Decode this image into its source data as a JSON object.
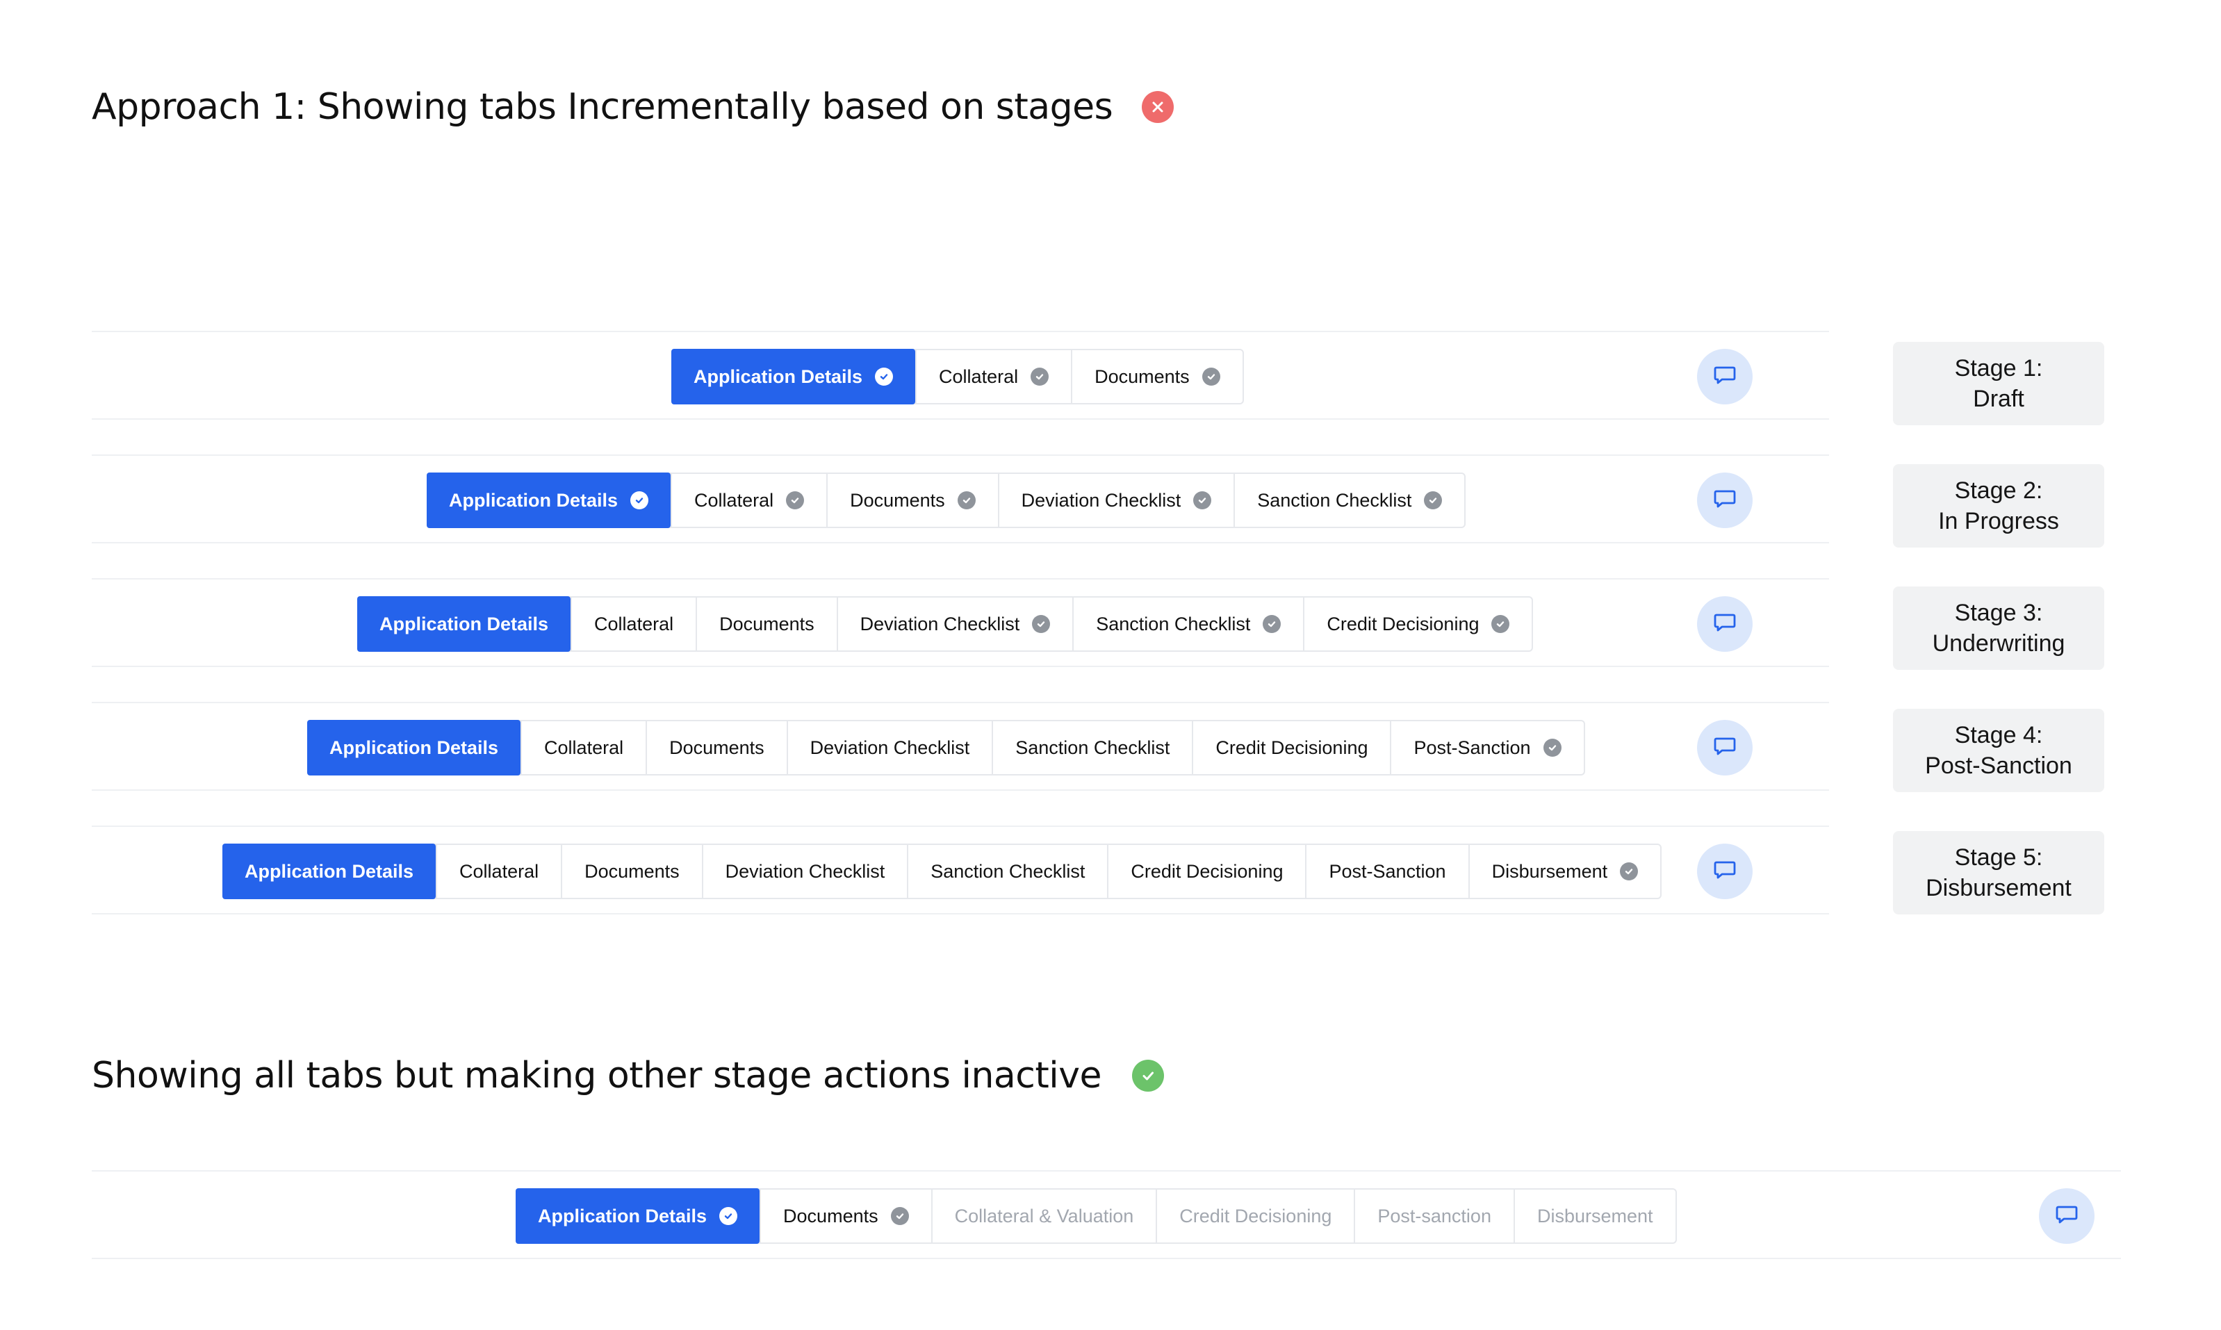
{
  "approach1": {
    "title": "Approach 1: Showing tabs Incrementally based on stages",
    "status": "rejected",
    "rows": [
      {
        "tabs": [
          {
            "label": "Application Details",
            "active": true,
            "check": true
          },
          {
            "label": "Collateral",
            "check": true
          },
          {
            "label": "Documents",
            "check": true
          }
        ],
        "stage": {
          "line1": "Stage 1:",
          "line2": "Draft"
        }
      },
      {
        "tabs": [
          {
            "label": "Application Details",
            "active": true,
            "check": true
          },
          {
            "label": "Collateral",
            "check": true
          },
          {
            "label": "Documents",
            "check": true
          },
          {
            "label": "Deviation Checklist",
            "check": true
          },
          {
            "label": "Sanction Checklist",
            "check": true
          }
        ],
        "stage": {
          "line1": "Stage 2:",
          "line2": "In Progress"
        }
      },
      {
        "tabs": [
          {
            "label": "Application Details",
            "active": true
          },
          {
            "label": "Collateral"
          },
          {
            "label": "Documents"
          },
          {
            "label": "Deviation Checklist",
            "check": true
          },
          {
            "label": "Sanction Checklist",
            "check": true
          },
          {
            "label": "Credit Decisioning",
            "check": true
          }
        ],
        "stage": {
          "line1": "Stage 3:",
          "line2": "Underwriting"
        }
      },
      {
        "tabs": [
          {
            "label": "Application Details",
            "active": true
          },
          {
            "label": "Collateral"
          },
          {
            "label": "Documents"
          },
          {
            "label": "Deviation Checklist"
          },
          {
            "label": "Sanction Checklist"
          },
          {
            "label": "Credit Decisioning"
          },
          {
            "label": "Post-Sanction",
            "check": true
          }
        ],
        "stage": {
          "line1": "Stage 4:",
          "line2": "Post-Sanction"
        }
      },
      {
        "tabs": [
          {
            "label": "Application Details",
            "active": true
          },
          {
            "label": "Collateral"
          },
          {
            "label": "Documents"
          },
          {
            "label": "Deviation Checklist"
          },
          {
            "label": "Sanction Checklist"
          },
          {
            "label": "Credit Decisioning"
          },
          {
            "label": "Post-Sanction"
          },
          {
            "label": "Disbursement",
            "check": true
          }
        ],
        "stage": {
          "line1": "Stage 5:",
          "line2": "Disbursement"
        }
      }
    ]
  },
  "approach2": {
    "title": "Showing all tabs but making other stage actions inactive",
    "status": "accepted",
    "tabs": [
      {
        "label": "Application Details",
        "active": true,
        "check": true
      },
      {
        "label": "Documents",
        "check": true
      },
      {
        "label": "Collateral & Valuation",
        "inactive": true
      },
      {
        "label": "Credit Decisioning",
        "inactive": true
      },
      {
        "label": "Post-sanction",
        "inactive": true
      },
      {
        "label": "Disbursement",
        "inactive": true
      }
    ]
  },
  "icons": {
    "rejected": "close-icon",
    "accepted": "check-icon",
    "tab_status": "check-circle-icon",
    "chat": "chat-icon"
  },
  "colors": {
    "primary": "#2563eb",
    "rejected": "#ef6b6b",
    "accepted": "#6cc36a",
    "chat_bg": "#dbe7fb",
    "inactive_text": "#a2a7af"
  }
}
